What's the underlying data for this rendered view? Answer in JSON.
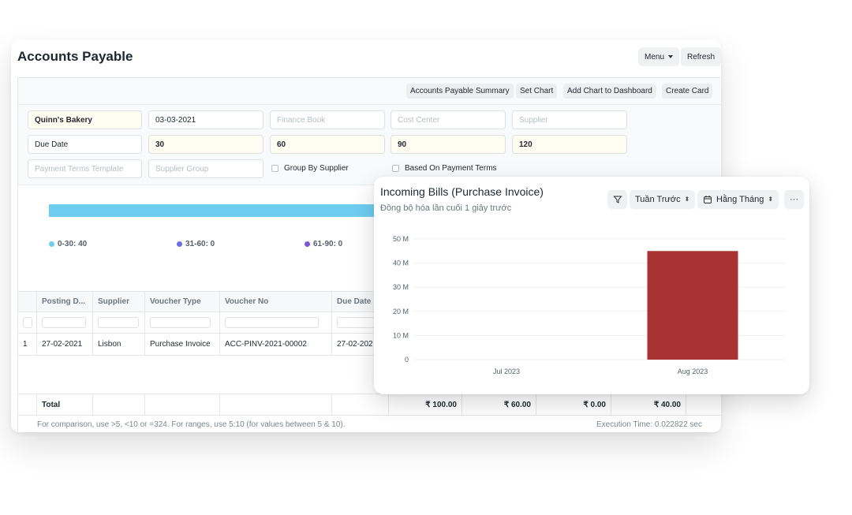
{
  "report": {
    "title": "Accounts Payable",
    "menu_label": "Menu",
    "refresh_label": "Refresh",
    "toolbar": [
      "Accounts Payable Summary",
      "Set Chart",
      "Add Chart to Dashboard",
      "Create Card"
    ],
    "filters": {
      "company": "Quinn's Bakery",
      "date": "03-03-2021",
      "finance_book": "Finance Book",
      "cost_center": "Cost Center",
      "supplier": "Supplier",
      "ageing_based_on": "Due Date",
      "range1": "30",
      "range2": "60",
      "range3": "90",
      "range4": "120",
      "payment_terms_template": "Payment Terms Template",
      "supplier_group": "Supplier Group",
      "group_by_supplier": "Group By Supplier",
      "based_on_payment_terms": "Based On Payment Terms"
    },
    "summary_legend": [
      "0-30: 40",
      "31-60: 0",
      "61-90: 0"
    ],
    "columns": [
      "Posting D...",
      "Supplier",
      "Voucher Type",
      "Voucher No",
      "Due Date"
    ],
    "rows": [
      {
        "idx": "1",
        "posting_date": "27-02-2021",
        "supplier": "Lisbon",
        "voucher_type": "Purchase Invoice",
        "voucher_no": "ACC-PINV-2021-00002",
        "due_date": "27-02-202"
      }
    ],
    "total_label": "Total",
    "totals": [
      "₹ 100.00",
      "₹ 60.00",
      "₹ 0.00",
      "₹ 40.00"
    ],
    "footer_hint": "For comparison, use >5, <10 or =324. For ranges, use 5:10 (for values between 5 & 10).",
    "execution_time": "Execution Time: 0.022822 sec"
  },
  "card": {
    "title": "Incoming Bills (Purchase Invoice)",
    "subtitle": "Đồng bộ hóa lần cuối 1 giây trước",
    "timespan_label": "Tuần Trước",
    "interval_label": "Hằng Tháng",
    "more_label": "···"
  },
  "colors": {
    "accent_bar": "#a83333",
    "summary_bar": "#6fcdf2",
    "legend_0_30": "#6fcdf2",
    "legend_31_60": "#6b6ee0",
    "legend_61_90": "#7b57d6"
  },
  "icons": {
    "filter": "filter-icon",
    "calendar": "calendar-icon",
    "more": "more-icon"
  },
  "chart_data": {
    "type": "bar",
    "categories": [
      "Jul 2023",
      "Aug 2023"
    ],
    "values": [
      0,
      45
    ],
    "ylim": [
      0,
      50
    ],
    "ytick_labels": [
      "0",
      "10 M",
      "20 M",
      "30 M",
      "40 M",
      "50 M"
    ],
    "ytick_values": [
      0,
      10,
      20,
      30,
      40,
      50
    ],
    "grid": true,
    "title": "",
    "xlabel": "",
    "ylabel": ""
  }
}
